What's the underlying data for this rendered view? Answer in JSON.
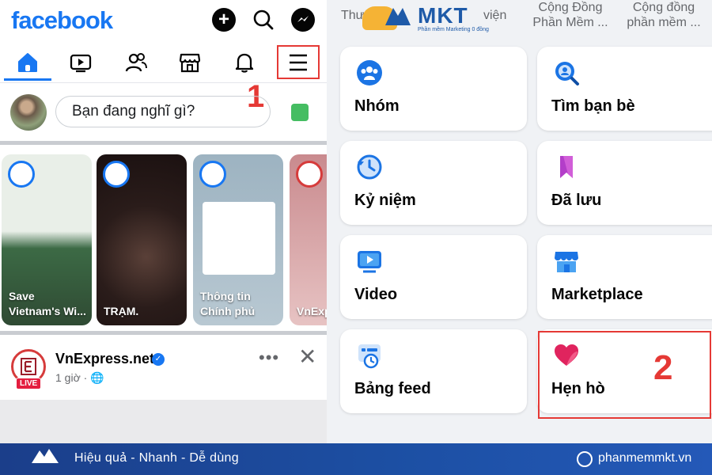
{
  "left": {
    "brand": "facebook",
    "nav": [
      "home-icon",
      "watch-icon",
      "friends-icon",
      "marketplace-icon",
      "bell-icon",
      "menu-icon"
    ],
    "step1": "1",
    "composer_placeholder": "Bạn đang nghĩ gì?",
    "stories": [
      {
        "label": "Save Vietnam's Wi...",
        "color": "#3f6b4a"
      },
      {
        "label": "TRẠM.",
        "color": "#3a2a28"
      },
      {
        "label": "Thông tin Chính phủ",
        "color": "#a6bac7"
      },
      {
        "label": "VnExp t",
        "color": "#d8a7a9"
      }
    ],
    "post": {
      "name": "VnExpress.net",
      "time": "1 giờ · 🌐",
      "live": "LIVE",
      "more": "•••",
      "close": "✕"
    }
  },
  "right": {
    "shortcuts": [
      "Thư",
      "viện",
      "Cộng Đồng Phần Mềm ...",
      "Cộng đồng phần mềm ..."
    ],
    "mkt_text": "MKT",
    "mkt_sub": "Phần mềm Marketing 0 đồng",
    "cards": [
      {
        "label": "Nhóm",
        "icon": "groups-icon"
      },
      {
        "label": "Tìm bạn bè",
        "icon": "find-friends-icon"
      },
      {
        "label": "Kỷ niệm",
        "icon": "memories-icon"
      },
      {
        "label": "Đã lưu",
        "icon": "saved-icon"
      },
      {
        "label": "Video",
        "icon": "video-icon"
      },
      {
        "label": "Marketplace",
        "icon": "marketplace-icon"
      },
      {
        "label": "Bảng feed",
        "icon": "feeds-icon"
      },
      {
        "label": "Hẹn hò",
        "icon": "dating-icon"
      }
    ],
    "step2": "2"
  },
  "footer": {
    "slogan": "Hiệu quả - Nhanh - Dễ dùng",
    "site": "phanmemmkt.vn"
  },
  "colors": {
    "fb_blue": "#1877f2",
    "highlight_red": "#e53935",
    "footer_blue": "#1c4fa3"
  }
}
